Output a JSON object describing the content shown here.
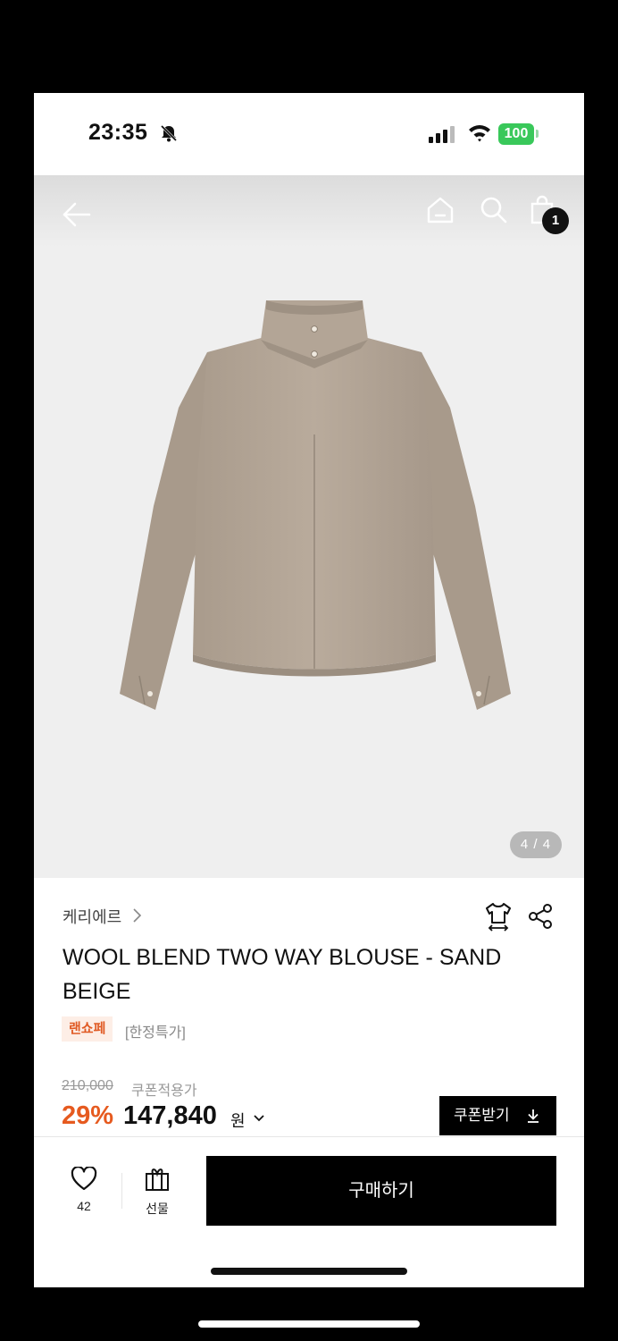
{
  "status_bar": {
    "time": "23:35",
    "battery": "100"
  },
  "gallery": {
    "cart_count": "1",
    "page_indicator": "4 / 4"
  },
  "product": {
    "brand": "케리에르",
    "title": "WOOL BLEND TWO WAY BLOUSE - SAND BEIGE",
    "tags": [
      "랜쇼페",
      "[한정특가]"
    ],
    "original_price": "210,000",
    "coupon_price_label": "쿠폰적용가",
    "discount": "29%",
    "price": "147,840",
    "currency": "원"
  },
  "actions": {
    "coupon_button": "쿠폰받기",
    "like_count": "42",
    "gift_label": "선물",
    "buy_label": "구매하기"
  },
  "colors": {
    "accent_orange": "#e65a1f",
    "battery_green": "#39c85a",
    "background_gray": "#efefef",
    "product_beige": "#b8aa9b"
  }
}
